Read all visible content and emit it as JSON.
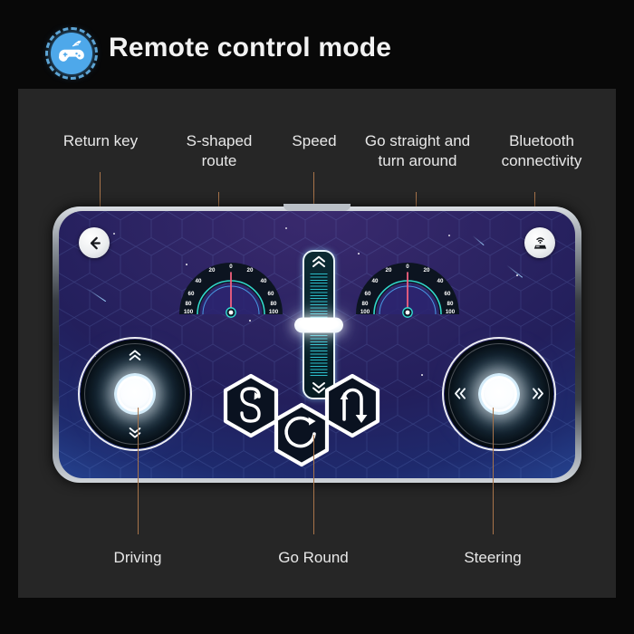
{
  "header": {
    "title": "Remote control mode",
    "icon": "gamepad-remote-icon",
    "icon_color": "#4ea8ea"
  },
  "panel": {
    "background_color": "#262626",
    "outer_background_color": "#080808"
  },
  "callouts": {
    "leader_color": "#a8744a",
    "top": [
      {
        "name": "return-key",
        "label": "Return key"
      },
      {
        "name": "s-shaped-route",
        "label": "S-shaped\nroute"
      },
      {
        "name": "speed",
        "label": "Speed"
      },
      {
        "name": "go-straight-turn-around",
        "label": "Go straight and\nturn around"
      },
      {
        "name": "bluetooth-connectivity",
        "label": "Bluetooth\nconnectivity"
      }
    ],
    "bottom": [
      {
        "name": "driving",
        "label": "Driving"
      },
      {
        "name": "go-round",
        "label": "Go Round"
      },
      {
        "name": "steering",
        "label": "Steering"
      }
    ]
  },
  "phone": {
    "screen": {
      "gradient_top": "#2b2362",
      "gradient_bottom": "#3f7ec8"
    },
    "return_button": {
      "icon": "arrow-left-icon"
    },
    "bluetooth_button": {
      "icon": "bluetooth-connectivity-icon"
    },
    "gauges": [
      {
        "name": "left-gauge",
        "tick_labels_left": [
          "0",
          "20",
          "40",
          "60",
          "80",
          "100"
        ],
        "tick_labels_right": [
          "0",
          "20",
          "40",
          "60",
          "80",
          "100"
        ],
        "needle_value": "0",
        "needle_color": "#f2607e",
        "arc_color": "#35e3d6"
      },
      {
        "name": "right-gauge",
        "tick_labels_left": [
          "0",
          "20",
          "40",
          "60",
          "80",
          "100"
        ],
        "tick_labels_right": [
          "0",
          "20",
          "40",
          "60",
          "80",
          "100"
        ],
        "needle_value": "0",
        "needle_color": "#f2607e",
        "arc_color": "#35e3d6"
      }
    ],
    "speed_slider": {
      "name": "speed-slider",
      "up_icon": "chevron-double-up-icon",
      "down_icon": "chevron-double-down-icon",
      "thumb_position_percent": 50
    },
    "left_joystick": {
      "name": "driving-joystick",
      "up_icon": "chevron-double-up-icon",
      "down_icon": "chevron-double-down-icon"
    },
    "right_joystick": {
      "name": "steering-joystick",
      "left_icon": "chevron-double-left-icon",
      "right_icon": "chevron-double-right-icon"
    },
    "hex_buttons": [
      {
        "name": "s-route-button",
        "glyph": "S",
        "icon": "s-curve-arrow-icon"
      },
      {
        "name": "go-round-button",
        "glyph": "C",
        "icon": "circular-arrow-icon"
      },
      {
        "name": "u-turn-button",
        "glyph": "",
        "icon": "u-turn-arrow-icon"
      }
    ]
  }
}
